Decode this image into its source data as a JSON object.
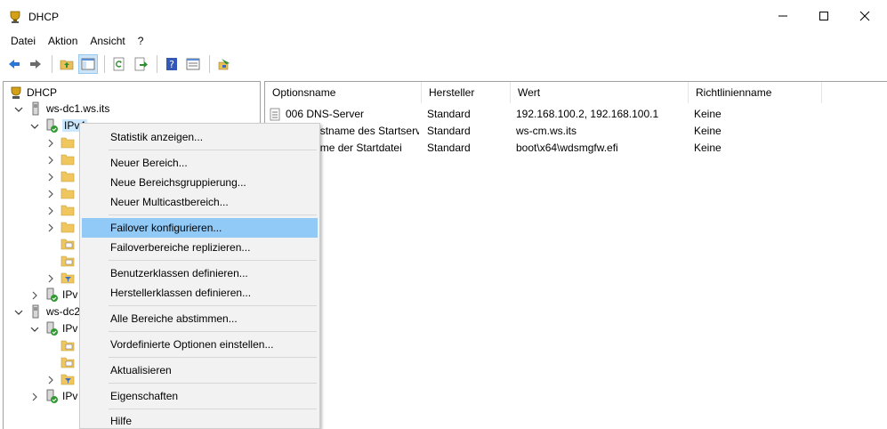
{
  "window": {
    "title": "DHCP"
  },
  "menu": [
    "Datei",
    "Aktion",
    "Ansicht",
    "?"
  ],
  "toolbar": [
    "back-icon",
    "forward-icon",
    "up-folder-icon",
    "show-hide-tree-icon",
    "refresh-icon",
    "export-icon",
    "help-icon",
    "properties-icon",
    "dhcp-options-icon"
  ],
  "tree": {
    "root": "DHCP",
    "server1": "ws-dc1.ws.its",
    "ipv4": "IPv4",
    "ipv6_1": "IPv",
    "server2": "ws-dc2",
    "ipv4_2": "IPv",
    "ipv6_2": "IPv"
  },
  "list": {
    "columns": [
      "Optionsname",
      "Hersteller",
      "Wert",
      "Richtlinienname"
    ],
    "rows": [
      [
        "006 DNS-Server",
        "Standard",
        "192.168.100.2, 192.168.100.1",
        "Keine"
      ],
      [
        "066 Hostname des Startservers",
        "Standard",
        "ws-cm.ws.its",
        "Keine"
      ],
      [
        "067 Name der Startdatei",
        "Standard",
        "boot\\x64\\wdsmgfw.efi",
        "Keine"
      ]
    ]
  },
  "context_menu": {
    "items": [
      "Statistik anzeigen...",
      "Neuer Bereich...",
      "Neue Bereichsgruppierung...",
      "Neuer Multicastbereich...",
      "Failover konfigurieren...",
      "Failoverbereiche replizieren...",
      "Benutzerklassen definieren...",
      "Herstellerklassen definieren...",
      "Alle Bereiche abstimmen...",
      "Vordefinierte Optionen einstellen...",
      "Aktualisieren",
      "Eigenschaften",
      "Hilfe"
    ],
    "highlighted": "Failover konfigurieren..."
  }
}
